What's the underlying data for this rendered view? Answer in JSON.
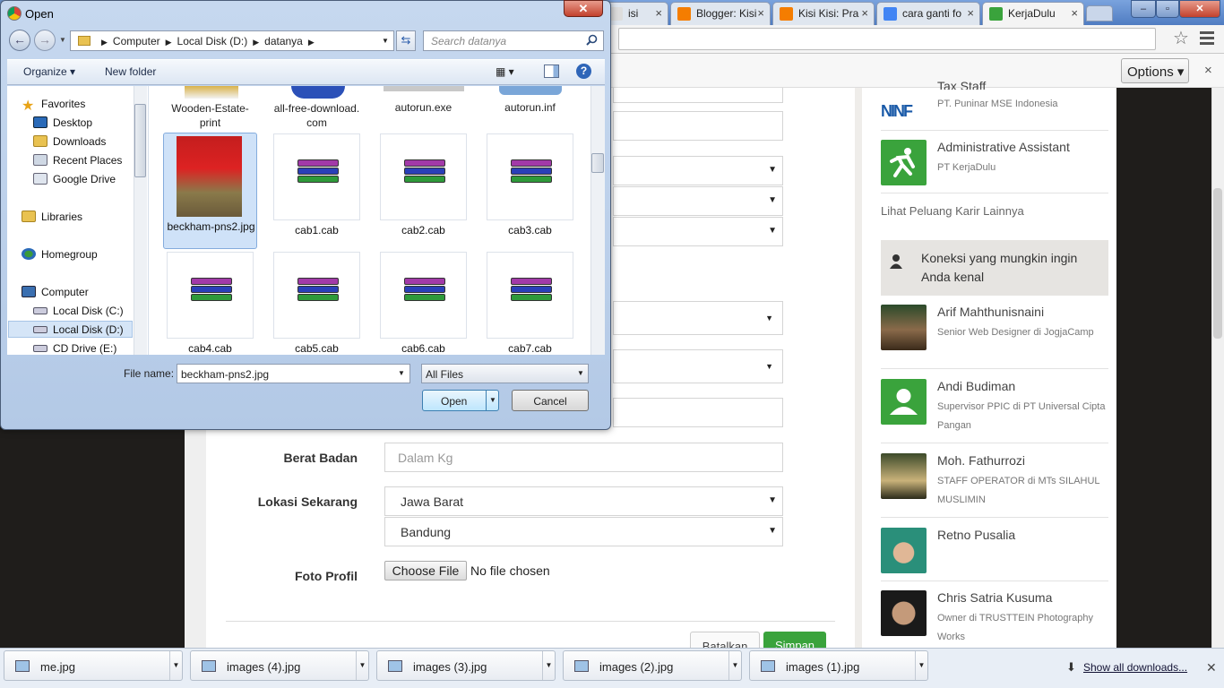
{
  "browser": {
    "tabs": [
      {
        "label": "isi",
        "favicon_color": "#dddddd"
      },
      {
        "label": "Blogger: Kisi",
        "favicon_color": "#f57d00"
      },
      {
        "label": "Kisi Kisi: Pra",
        "favicon_color": "#f57d00"
      },
      {
        "label": "cara ganti fo",
        "favicon_color": "#4285f4"
      },
      {
        "label": "KerjaDulu",
        "favicon_color": "#3aa33c"
      }
    ],
    "options_label": "Options ▾",
    "close_label": "×"
  },
  "form": {
    "fields": [
      {
        "label": "Berat Badan",
        "placeholder": "Dalam Kg"
      },
      {
        "label": "Lokasi Sekarang",
        "value": "Jawa Barat",
        "value2": "Bandung"
      },
      {
        "label": "Foto Profil"
      }
    ],
    "choose_file_label": "Choose File",
    "no_file_text": "No file chosen",
    "cancel_label": "Batalkan",
    "save_label": "Simpan"
  },
  "sidebar": {
    "jobs": [
      {
        "title": "Tax Staff",
        "company": "PT. Puninar MSE Indonesia"
      },
      {
        "title": "Administrative Assistant",
        "company": "PT KerjaDulu"
      }
    ],
    "more_careers_label": "Lihat Peluang Karir Lainnya",
    "connections_title": "Koneksi yang mungkin ingin Anda kenal",
    "people": [
      {
        "name": "Arif Mahthunisnaini",
        "role": "Senior Web Designer di JogjaCamp"
      },
      {
        "name": "Andi Budiman",
        "role": "Supervisor PPIC di PT Universal Cipta Pangan"
      },
      {
        "name": "Moh. Fathurrozi",
        "role": "STAFF OPERATOR di MTs SILAHUL MUSLIMIN"
      },
      {
        "name": "Retno Pusalia",
        "role": ""
      },
      {
        "name": "Chris Satria Kusuma",
        "role": "Owner di TRUSTTEIN Photography Works"
      }
    ]
  },
  "downloads": {
    "items": [
      "me.jpg",
      "images (4).jpg",
      "images (3).jpg",
      "images (2).jpg",
      "images (1).jpg"
    ],
    "show_all_label": "Show all downloads..."
  },
  "dialog": {
    "title": "Open",
    "breadcrumb": [
      "Computer",
      "Local Disk (D:)",
      "datanya"
    ],
    "search_placeholder": "Search datanya",
    "organize_label": "Organize ▾",
    "new_folder_label": "New folder",
    "nav": {
      "favorites": "Favorites",
      "desktop": "Desktop",
      "downloads": "Downloads",
      "recent": "Recent Places",
      "gdrive": "Google Drive",
      "libraries": "Libraries",
      "homegroup": "Homegroup",
      "computer": "Computer",
      "disk_c": "Local Disk (C:)",
      "disk_d": "Local Disk (D:)",
      "cd": "CD Drive (E:)"
    },
    "files": [
      {
        "name": "Wooden-Estate-print"
      },
      {
        "name": "all-free-download.com"
      },
      {
        "name": "autorun.exe"
      },
      {
        "name": "autorun.inf"
      },
      {
        "name": "beckham-pns2.jpg"
      },
      {
        "name": "cab1.cab"
      },
      {
        "name": "cab2.cab"
      },
      {
        "name": "cab3.cab"
      },
      {
        "name": "cab4.cab"
      },
      {
        "name": "cab5.cab"
      },
      {
        "name": "cab6.cab"
      },
      {
        "name": "cab7.cab"
      }
    ],
    "file_name_label": "File name:",
    "file_name_value": "beckham-pns2.jpg",
    "file_type_value": "All Files",
    "open_label": "Open",
    "cancel_label": "Cancel"
  }
}
